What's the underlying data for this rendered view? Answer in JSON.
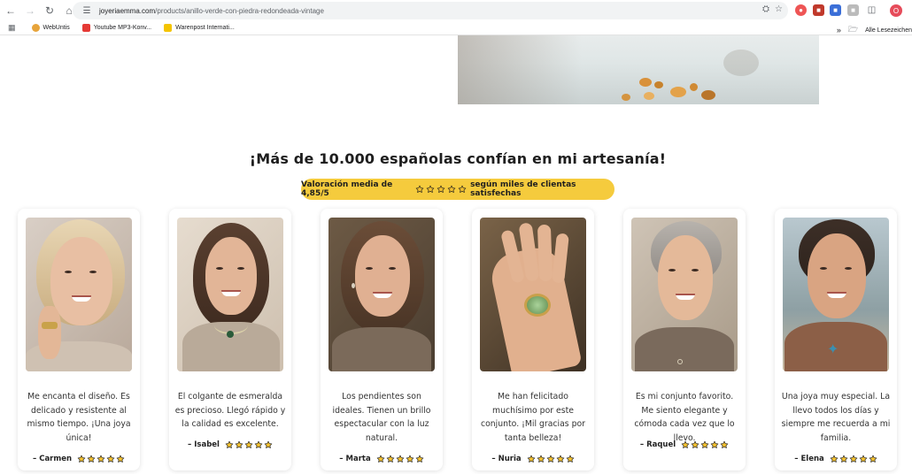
{
  "browser": {
    "url_host": "joyeriaemma.com",
    "url_path": "/products/anillo-verde-con-piedra-redondeada-vintage",
    "profile_initial": "O",
    "bookmarks": [
      {
        "label": "WebUntis",
        "color": "#e7a43b"
      },
      {
        "label": "Youtube MP3-Konv...",
        "color": "#e53935"
      },
      {
        "label": "Warenpost Internati...",
        "color": "#f4c400"
      }
    ],
    "all_bookmarks_label": "Alle Lesezeichen"
  },
  "section": {
    "headline": "¡Más de 10.000 españolas confían en mi artesanía!",
    "rating_prefix": "Valoración media de 4,85/5",
    "rating_suffix": "según miles de clientas satisfechas",
    "rating_stars": 5
  },
  "colors": {
    "pill": "#f5cb3d",
    "star_fill": "#f5c12e",
    "star_stroke": "#1f1f1f"
  },
  "testimonials": [
    {
      "quote": "Me encanta el diseño. Es delicado y resistente al mismo tiempo. ¡Una joya única!",
      "name": "Carmen",
      "stars": 5,
      "photo": "woman-with-ring-portrait"
    },
    {
      "quote": "El colgante de esmeralda es precioso. Llegó rápido y la calidad es excelente.",
      "name": "Isabel",
      "stars": 5,
      "photo": "woman-with-pendant-portrait"
    },
    {
      "quote": "Los pendientes son ideales. Tienen un brillo espectacular con la luz natural.",
      "name": "Marta",
      "stars": 5,
      "photo": "woman-with-earrings-portrait"
    },
    {
      "quote": "Me han felicitado muchísimo por este conjunto. ¡Mil gracias por tanta belleza!",
      "name": "Nuria",
      "stars": 5,
      "photo": "hand-with-green-ring"
    },
    {
      "quote": "Es mi conjunto favorito. Me siento elegante y cómoda cada vez que lo llevo.",
      "name": "Raquel",
      "stars": 5,
      "photo": "woman-short-grey-hair-portrait"
    },
    {
      "quote": "Una joya muy especial. La llevo todos los días y siempre me recuerda a mi familia.",
      "name": "Elena",
      "stars": 5,
      "photo": "woman-starfish-pendant-portrait"
    }
  ]
}
